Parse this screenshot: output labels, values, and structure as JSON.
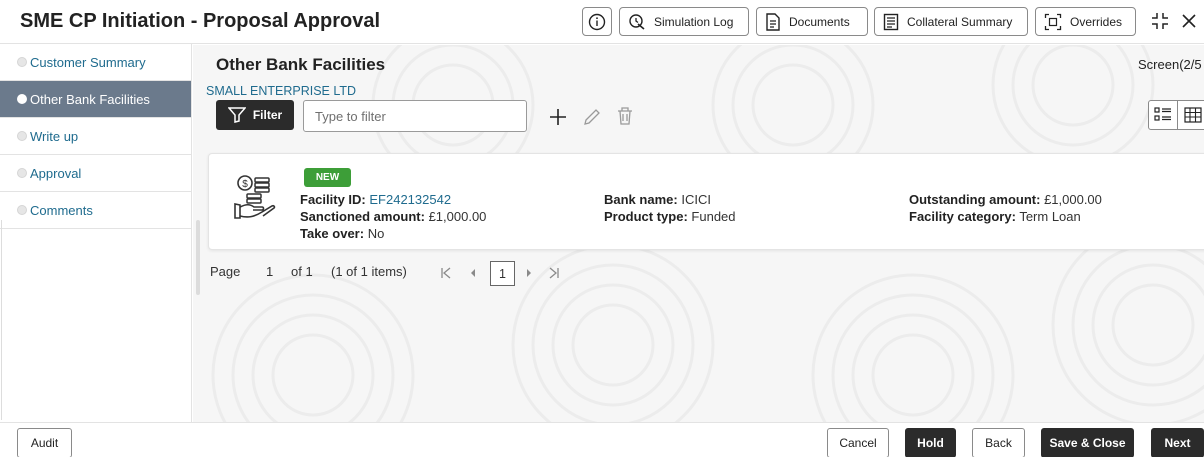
{
  "header": {
    "title": "SME CP Initiation - Proposal Approval",
    "buttons": {
      "simulation_log": "Simulation Log",
      "documents": "Documents",
      "collateral_summary": "Collateral Summary",
      "overrides": "Overrides"
    }
  },
  "sidebar": {
    "items": [
      {
        "label": "Customer Summary",
        "active": false
      },
      {
        "label": "Other Bank Facilities",
        "active": true
      },
      {
        "label": "Write up",
        "active": false
      },
      {
        "label": "Approval",
        "active": false
      },
      {
        "label": "Comments",
        "active": false
      }
    ]
  },
  "main": {
    "title": "Other Bank Facilities",
    "screen_indicator": "Screen(2/5",
    "company": "SMALL ENTERPRISE LTD",
    "filter_label": "Filter",
    "filter_placeholder": "Type to filter",
    "card": {
      "badge": "NEW",
      "facility_id_label": "Facility ID:",
      "facility_id": "EF242132542",
      "sanctioned_label": "Sanctioned amount:",
      "sanctioned": "£1,000.00",
      "takeover_label": "Take over:",
      "takeover": "No",
      "bank_label": "Bank name:",
      "bank": "ICICI",
      "product_label": "Product type:",
      "product": "Funded",
      "outstanding_label": "Outstanding amount:",
      "outstanding": "£1,000.00",
      "category_label": "Facility category:",
      "category": "Term Loan"
    },
    "pagination": {
      "page_label": "Page",
      "page": "1",
      "of_label": "of 1",
      "items": "(1 of 1 items)",
      "current": "1"
    }
  },
  "footer": {
    "audit": "Audit",
    "cancel": "Cancel",
    "hold": "Hold",
    "back": "Back",
    "save_close": "Save & Close",
    "next": "Next"
  },
  "colors": {
    "accent_link": "#1f6b8e",
    "active_nav": "#6b7a8c",
    "dark_button": "#2b2b2b",
    "badge_green": "#3d9e38"
  },
  "icons": [
    "info-icon",
    "simulation-log-icon",
    "documents-icon",
    "collateral-icon",
    "overrides-icon",
    "expand-icon",
    "close-icon",
    "filter-icon",
    "add-icon",
    "edit-icon",
    "delete-icon",
    "list-view-icon",
    "grid-view-icon",
    "facility-money-icon"
  ]
}
